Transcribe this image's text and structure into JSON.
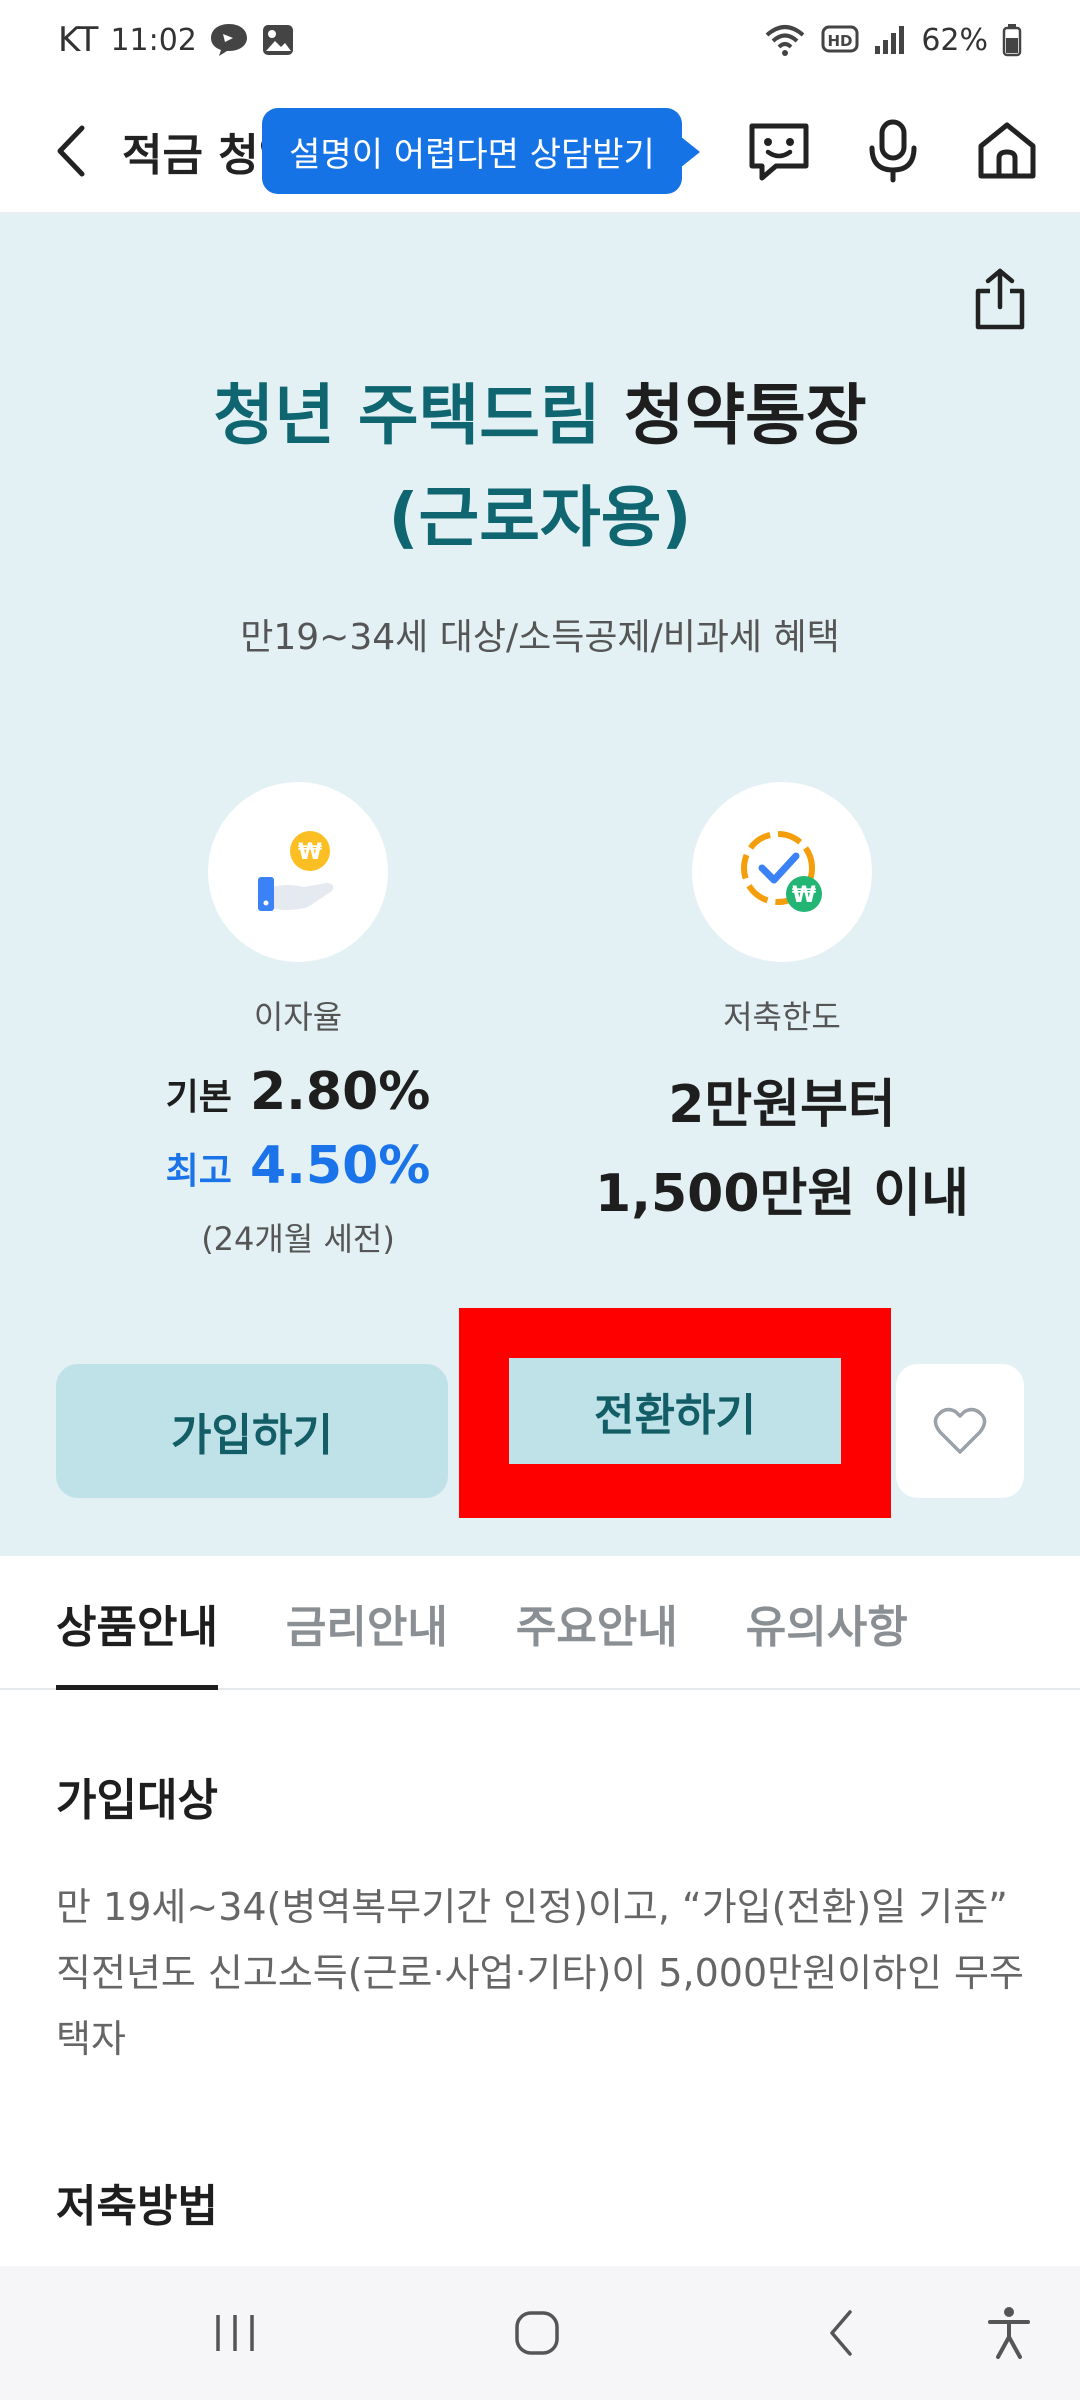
{
  "status_bar": {
    "carrier": "KT",
    "time": "11:02",
    "battery": "62%",
    "icons": [
      "talk-bubble-icon",
      "gallery-icon",
      "wifi-icon",
      "hd-voice-icon",
      "signal-icon",
      "battery-icon"
    ]
  },
  "header": {
    "title": "적금 청약",
    "tooltip": "설명이 어렵다면 상담받기",
    "icons": [
      "back-arrow-icon",
      "chat-bot-icon",
      "microphone-icon",
      "home-icon"
    ]
  },
  "product": {
    "title_part1": "청년 주택드림 ",
    "title_part2": "청약통장",
    "title_line2": "(근로자용)",
    "subtitle": "만19~34세 대상/소득공제/비과세 혜택",
    "rate": {
      "label": "이자율",
      "base_prefix": "기본",
      "base_value": "2.80%",
      "max_prefix": "최고",
      "max_value": "4.50%",
      "note": "(24개월 세전)"
    },
    "limit": {
      "label": "저축한도",
      "line1": "2만원부터",
      "line2": "1,500만원 이내"
    }
  },
  "buttons": {
    "join": "가입하기",
    "switch": "전환하기"
  },
  "tabs": [
    {
      "label": "상품안내",
      "active": true
    },
    {
      "label": "금리안내",
      "active": false
    },
    {
      "label": "주요안내",
      "active": false
    },
    {
      "label": "유의사항",
      "active": false
    }
  ],
  "content": {
    "section1_title": "가입대상",
    "section1_body": "만 19세~34(병역복무기간 인정)이고, “가입(전환)일 기준” 직전년도 신고소득(근로·사업·기타)이 5,000만원이하인 무주택자",
    "section2_title": "저축방법"
  },
  "colors": {
    "hero_bg": "#e3f1f4",
    "brand_teal": "#0f6670",
    "accent_blue": "#1a73e8",
    "button_bg": "#bfe1e8",
    "highlight": "#ff0000"
  }
}
